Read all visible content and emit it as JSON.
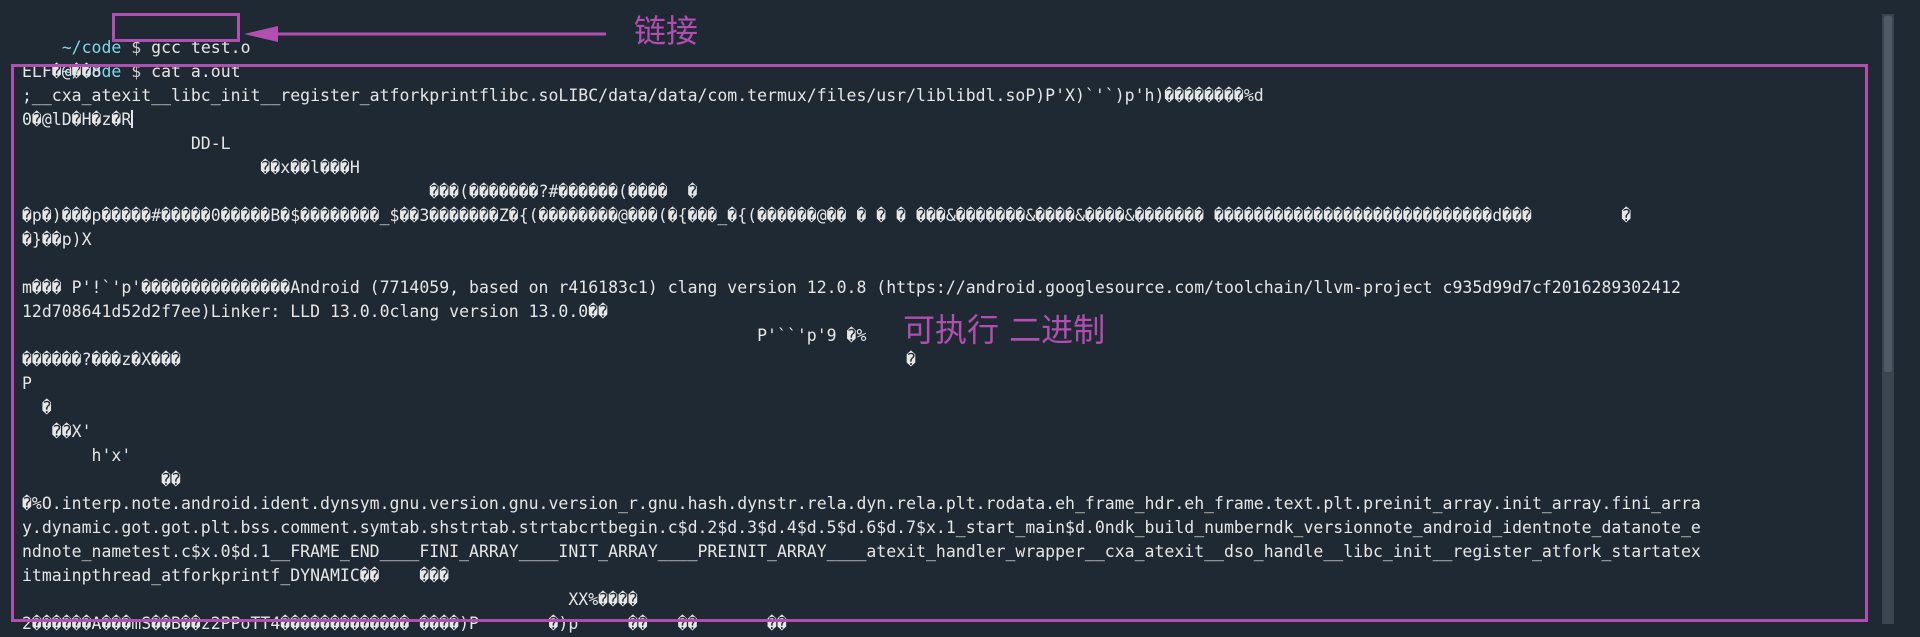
{
  "prompt": {
    "path": "~/code",
    "dollar": "$"
  },
  "commands": [
    "gcc test.o",
    "cat a.out"
  ],
  "output_lines": [
    "ELF�@��8",
    ";__cxa_atexit__libc_init__register_atforkprintflibc.soLIBC/data/data/com.termux/files/usr/liblibdl.soP)P'X)`'`)p'h)��������%d",
    "0�@lD�H�z�R",
    "                 DD-L",
    "                        ��x��l���H",
    "                                         ���(�������?#������(����  �",
    "�p�)���p�����#�����0�����B�$��������_$��3�������Z�{(��������@���(�{���_�{(������@�� � � � ���&�������&����&����&������� ����������������������������d���         �",
    "�}��p)X",
    "",
    "m��� P'!`'p'���������������Android (7714059, based on r416183c1) clang version 12.0.8 (https://android.googlesource.com/toolchain/llvm-project c935d99d7cf2016289302412",
    "12d708641d52d2f7ee)Linker: LLD 13.0.0clang version 13.0.0��",
    "                                                                          P'``'p'9 �%",
    "������?���z�X���                                                                         �",
    "P",
    "  �",
    "   ��X'",
    "       h'x'",
    "              ��",
    "�%O.interp.note.android.ident.dynsym.gnu.version.gnu.version_r.gnu.hash.dynstr.rela.dyn.rela.plt.rodata.eh_frame_hdr.eh_frame.text.plt.preinit_array.init_array.fini_arra",
    "y.dynamic.got.got.plt.bss.comment.symtab.shstrtab.strtabcrtbegin.c$d.2$d.3$d.4$d.5$d.6$d.7$x.1_start_main$d.0ndk_build_numberndk_versionnote_android_identnote_datanote_e",
    "ndnote_nametest.c$x.0$d.1__FRAME_END____FINI_ARRAY____INIT_ARRAY____PREINIT_ARRAY____atexit_handler_wrapper__cxa_atexit__dso_handle__libc_init__register_atfork_startatex",
    "itmainpthread_atforkprintf_DYNAMIC��    ���",
    "                                                       XX%����",
    "2������A���mS��B��z2PPoTT4������������� ����)P       �)p     ��   ��       ��"
  ],
  "annotations": {
    "link_label": "链接",
    "exe_label": "可执行 二进制"
  },
  "colors": {
    "annotation": "#b14fb0",
    "background": "#1f2933",
    "prompt_path": "#7fd8e6"
  }
}
